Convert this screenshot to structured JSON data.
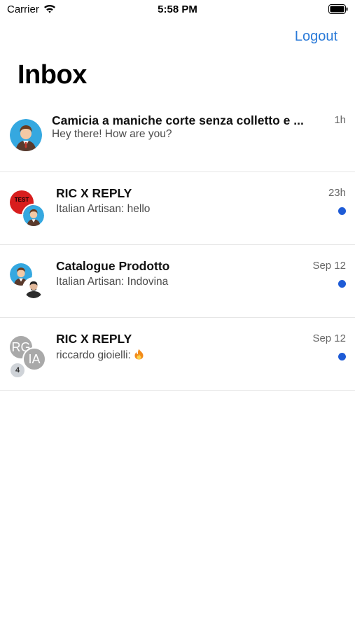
{
  "status_bar": {
    "carrier": "Carrier",
    "time": "5:58 PM"
  },
  "nav": {
    "logout_label": "Logout",
    "title": "Inbox"
  },
  "conversations": [
    {
      "title": "Camicia a maniche corte senza colletto e ...",
      "subtitle": "Hey there! How are you?",
      "time": "1h",
      "unread": false
    },
    {
      "title": "RIC X REPLY",
      "subtitle": "Italian Artisan: hello",
      "time": "23h",
      "unread": true,
      "avatar_text": "TEST"
    },
    {
      "title": "Catalogue Prodotto",
      "subtitle": "Italian Artisan: Indovina",
      "time": "Sep 12",
      "unread": true
    },
    {
      "title": "RIC X REPLY",
      "subtitle": "riccardo gioielli: ",
      "time": "Sep 12",
      "unread": true,
      "avatar_initials": [
        "RG",
        "IA"
      ],
      "participant_badge": "4"
    }
  ],
  "icons": {
    "wifi": "wifi-icon",
    "battery": "battery-icon",
    "fire": "fire-emoji"
  },
  "colors": {
    "accent": "#2a7ad8",
    "unread": "#1e5bd6",
    "separator": "#e6e6e6"
  }
}
